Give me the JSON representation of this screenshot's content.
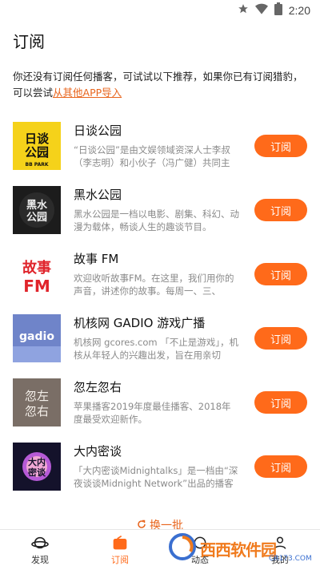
{
  "status": {
    "time": "2:20"
  },
  "page": {
    "title": "订阅"
  },
  "intro": {
    "text": "你还没有订阅任何播客，可试试以下推荐，如果你已有订阅猎豹，可以尝试",
    "link": "从其他APP导入"
  },
  "subscribe_label": "订阅",
  "podcasts": [
    {
      "name": "日谈公园",
      "desc": "“日谈公园”是由文娱领域资深人士李叔（李志明）和小伙子（冯广健）共同主",
      "cover_text": "日谈\n公园",
      "cover_sub": "BB PARK"
    },
    {
      "name": "黑水公园",
      "desc": "黑水公园是一档以电影、剧集、科幻、动漫为载体，畅谈人生的趣谈节目。",
      "cover_text": "黑水\n公园"
    },
    {
      "name": "故事 FM",
      "desc": "欢迎收听故事FM。在这里，我们用你的声音，讲述你的故事。每周一、三、",
      "cover_text": "故事\nFM"
    },
    {
      "name": "机核网 GADIO 游戏广播",
      "desc": "机核网 gcores.com 「不止是游戏」，机核从年轻人的兴趣出发，旨在用亲切",
      "cover_text": "gadio"
    },
    {
      "name": "忽左忽右",
      "desc": "苹果播客2019年度最佳播客、2018年度最受欢迎新作。",
      "cover_text": "忽左\n忽右"
    },
    {
      "name": "大内密谈",
      "desc": "「大内密谈Midnightalks」是一档由“深夜谈谈Midnight Network”出品的播客节",
      "cover_text": "大内\n密谈"
    }
  ],
  "refresh_label": "换一批",
  "nav": [
    {
      "label": "发现",
      "icon": "planet-icon"
    },
    {
      "label": "订阅",
      "icon": "radio-icon"
    },
    {
      "label": "动态",
      "icon": "activity-icon"
    },
    {
      "label": "我的",
      "icon": "user-icon"
    }
  ],
  "watermark": {
    "text": "西西软件园",
    "sub": "CR173.COM"
  },
  "colors": {
    "accent": "#ff6a1a",
    "link": "#e8651d"
  }
}
